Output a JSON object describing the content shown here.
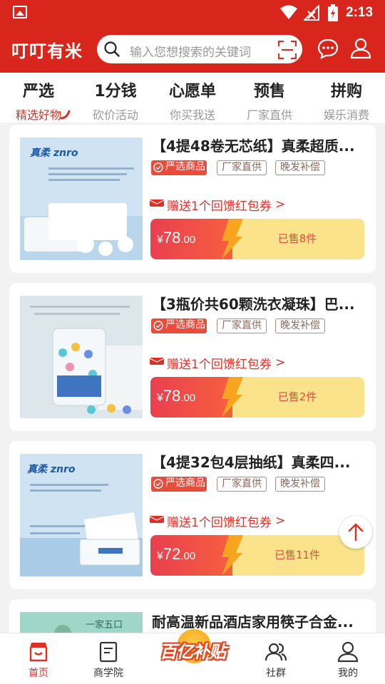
{
  "status": {
    "time": "2:13"
  },
  "header": {
    "logo": "叮叮有米",
    "search_placeholder": "输入您想搜索的关键词"
  },
  "tabs": [
    {
      "title": "严选",
      "subtitle": "精选好物"
    },
    {
      "title": "1分钱",
      "subtitle": "砍价活动"
    },
    {
      "title": "心愿单",
      "subtitle": "你买我送"
    },
    {
      "title": "预售",
      "subtitle": "厂家直供"
    },
    {
      "title": "拼购",
      "subtitle": "娱乐消费"
    }
  ],
  "tags": {
    "strict": "严选商品",
    "factory": "厂家直供",
    "late": "晚发补偿"
  },
  "products": [
    {
      "title": "【4提48卷无芯纸】真柔超质...",
      "gift": "赠送1个回馈红包券",
      "price_int": "78",
      "price_dec": ".00",
      "sold": "已售8件",
      "brand": "真柔 znro"
    },
    {
      "title": "【3瓶价共60颗洗衣凝珠】巴...",
      "gift": "赠送1个回馈红包券",
      "price_int": "78",
      "price_dec": ".00",
      "sold": "已售2件",
      "brand": ""
    },
    {
      "title": "【4提32包4层抽纸】真柔四...",
      "gift": "赠送1个回馈红包券",
      "price_int": "72",
      "price_dec": ".00",
      "sold": "已售11件",
      "brand": "真柔 znro"
    },
    {
      "title": "耐高温新品酒店家用筷子合金...",
      "thumb_text": "一家五口"
    }
  ],
  "currency": "¥",
  "chevron": ">",
  "bottom_nav": [
    {
      "label": "首页"
    },
    {
      "label": "商学院"
    },
    {
      "label": "百亿补贴"
    },
    {
      "label": "社群"
    },
    {
      "label": "我的"
    }
  ],
  "colors": {
    "brand": "#d9261c",
    "accent": "#e02e20",
    "sold_bg": "#fae38a"
  }
}
